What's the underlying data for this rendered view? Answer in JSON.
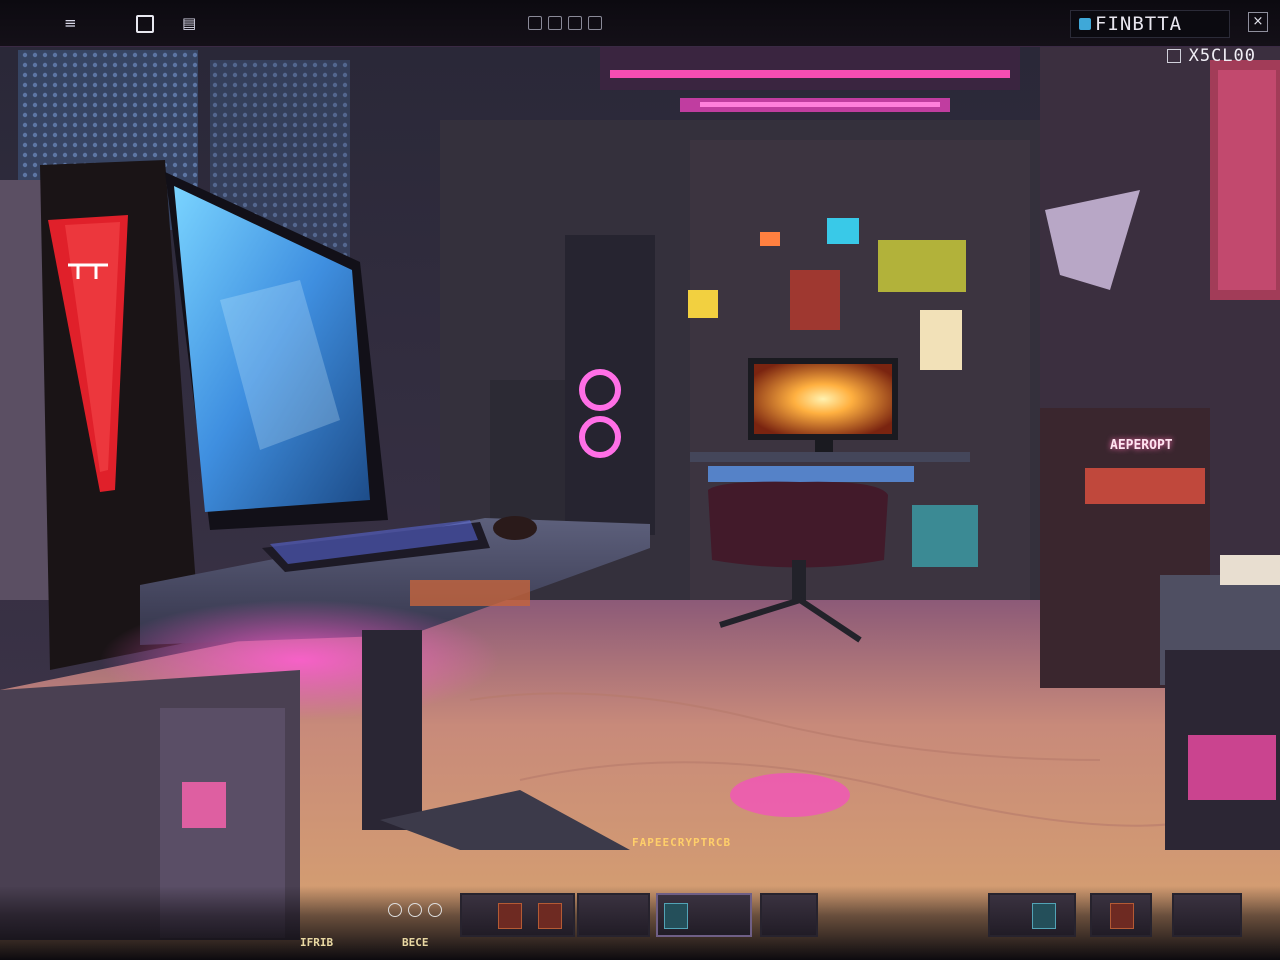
{
  "hud": {
    "top_right_label": "FINBTTA",
    "readout": "X5CL00",
    "close_button": "×"
  },
  "scene": {
    "wall_sign": "AEPEROPT",
    "floor_marking": "FAPEECRYPTRCB"
  },
  "bottom": {
    "left_label": "IFRIB",
    "center_label": "BECE"
  },
  "colors": {
    "neon_pink": "#ff4fb8",
    "neon_cyan": "#49c9ff",
    "desk_slate": "#4a4f6a",
    "floor_peach": "#d9a27c",
    "tower_red": "#e0202a"
  },
  "icons": [
    "window-icon",
    "folder-icon",
    "disk-icon",
    "settings-icon",
    "close-icon",
    "inventory-slot"
  ]
}
